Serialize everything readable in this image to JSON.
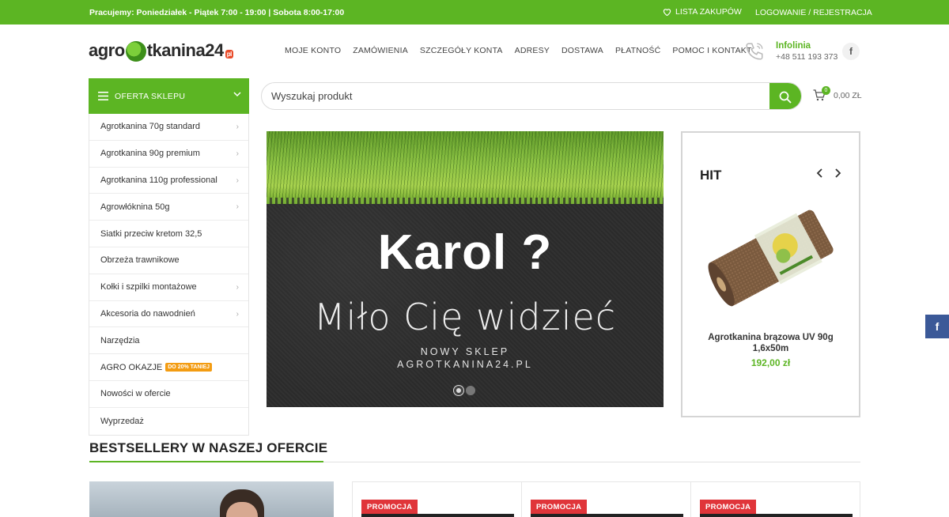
{
  "topbar": {
    "hours": "Pracujemy: Poniedziałek - Piątek 7:00 - 19:00 | Sobota 8:00-17:00",
    "wishlist": "LISTA ZAKUPÓW",
    "login": "LOGOWANIE / REJESTRACJA"
  },
  "logo": {
    "part1": "agro",
    "part2": "tkanina24",
    "badge": "pl"
  },
  "nav": [
    "MOJE KONTO",
    "ZAMÓWIENIA",
    "SZCZEGÓŁY KONTA",
    "ADRESY",
    "DOSTAWA",
    "PŁATNOŚĆ",
    "POMOC I KONTAKT"
  ],
  "infolinia": {
    "title": "Infolinia",
    "phone": "+48 511 193 373"
  },
  "category_button": "OFERTA SKLEPU",
  "categories": [
    "Agrotkanina 70g standard",
    "Agrotkanina 90g premium",
    "Agrotkanina 110g professional",
    "Agrowłóknina 50g",
    "Siatki przeciw kretom 32,5",
    "Obrzeża trawnikowe",
    "Kołki i szpilki montażowe",
    "Akcesoria do nawodnień",
    "Narzędzia",
    "AGRO OKAZJE",
    "Nowości w ofercie",
    "Wyprzedaż"
  ],
  "categories_tag": "DO 20% TANIEJ",
  "search": {
    "placeholder": "Wyszukaj produkt"
  },
  "cart": {
    "count": "0",
    "amount": "0,00 ZŁ"
  },
  "slider": {
    "headline": "Karol ?",
    "subheadline": "Miło Cię widzieć",
    "line1": "NOWY SKLEP",
    "line2": "AGROTKANINA24.PL"
  },
  "hit": {
    "title": "HIT",
    "product_name": "Agrotkanina brązowa UV 90g 1,6x50m",
    "price": "192,00 zł"
  },
  "bestsellers_title": "BESTSELLERY W NASZEJ OFERCIE",
  "promo_label": "PROMOCJA",
  "colors": {
    "brand_green": "#5cb523",
    "promo_red": "#e0353a",
    "tag_orange": "#f39c12",
    "facebook": "#3b5998"
  },
  "icons": [
    "heart-icon",
    "phone-icon",
    "facebook-icon",
    "menu-icon",
    "chevron-down-icon",
    "chevron-right-icon",
    "search-icon",
    "cart-icon",
    "arrow-left-icon",
    "arrow-right-icon"
  ]
}
